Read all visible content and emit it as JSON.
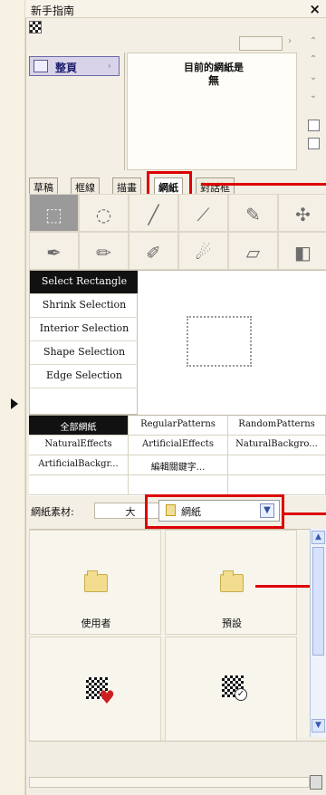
{
  "titlebar": {
    "title": "新手指南",
    "close": "×"
  },
  "page_list": {
    "selected_item": "整頁",
    "chevron": "›"
  },
  "info_panel": {
    "title": "目前的網紙是",
    "value": "無"
  },
  "tabs": [
    {
      "label": "草稿",
      "active": false
    },
    {
      "label": "框線",
      "active": false
    },
    {
      "label": "描畫",
      "active": false
    },
    {
      "label": "網紙",
      "active": true
    },
    {
      "label": "對話框",
      "active": false
    }
  ],
  "tools": [
    {
      "icon": "select-rect-icon",
      "glyph": "⬚",
      "selected": true
    },
    {
      "icon": "lasso-icon",
      "glyph": "◌",
      "selected": false
    },
    {
      "icon": "line-tool-icon",
      "glyph": "╱",
      "selected": false
    },
    {
      "icon": "wand-icon",
      "glyph": "⟋",
      "selected": false
    },
    {
      "icon": "eyedropper-icon",
      "glyph": "✎",
      "selected": false
    },
    {
      "icon": "move-icon",
      "glyph": "✣",
      "selected": false
    },
    {
      "icon": "pen-icon",
      "glyph": "✒",
      "selected": false
    },
    {
      "icon": "pencil-icon",
      "glyph": "✏",
      "selected": false
    },
    {
      "icon": "brush-icon",
      "glyph": "✐",
      "selected": false
    },
    {
      "icon": "airbrush-icon",
      "glyph": "☄",
      "selected": false
    },
    {
      "icon": "eraser-icon",
      "glyph": "▱",
      "selected": false
    },
    {
      "icon": "fill-icon",
      "glyph": "◧",
      "selected": false
    }
  ],
  "selection_modes": [
    {
      "label": "Select Rectangle",
      "active": true
    },
    {
      "label": "Shrink Selection",
      "active": false
    },
    {
      "label": "Interior Selection",
      "active": false
    },
    {
      "label": "Shape Selection",
      "active": false
    },
    {
      "label": "Edge Selection",
      "active": false
    }
  ],
  "categories": [
    {
      "label": "全部網紙",
      "active": true
    },
    {
      "label": "RegularPatterns",
      "active": false
    },
    {
      "label": "RandomPatterns",
      "active": false
    },
    {
      "label": "NaturalEffects",
      "active": false
    },
    {
      "label": "ArtificialEffects",
      "active": false
    },
    {
      "label": "NaturalBackgro...",
      "active": false
    },
    {
      "label": "ArtificialBackgr...",
      "active": false
    },
    {
      "label": "編輯關鍵字...",
      "active": false
    }
  ],
  "material": {
    "label": "網紙素材:",
    "size": "大",
    "selected_folder": "網紙"
  },
  "folders": [
    {
      "label": "使用者"
    },
    {
      "label": "預設"
    }
  ]
}
